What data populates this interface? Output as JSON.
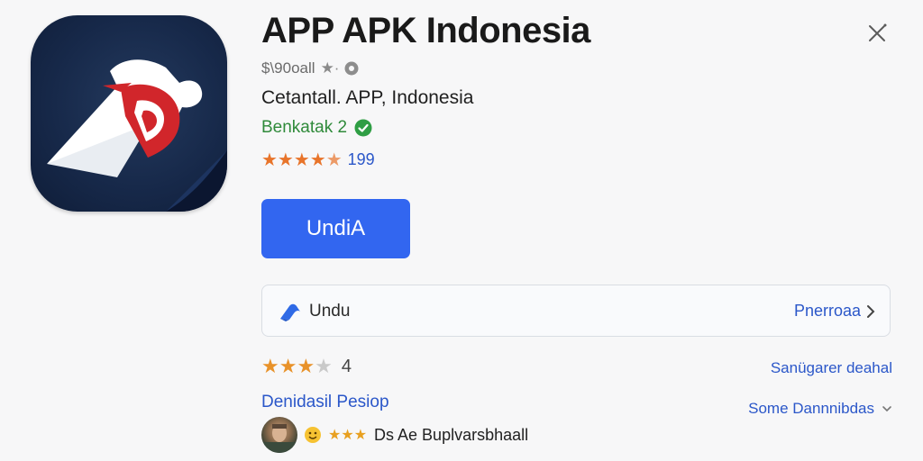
{
  "app": {
    "title": "APP APK  Indonesia",
    "developer": "$\\90oall",
    "subtitle": "Cetantall. APP, Indonesia",
    "verified_label": "Benkatak 2",
    "rating_stars": 4.5,
    "rating_count": "199"
  },
  "actions": {
    "install_label": "UndiA"
  },
  "download_bar": {
    "label": "Undu",
    "link_label": "Pnerroaa"
  },
  "reviews": {
    "stars": 3.5,
    "value": "4",
    "right_link": "Sanügarer deahal",
    "details_link": "Denidasil Pesiop",
    "more_link": "Some Dannnibdas",
    "reviewer_stars": 3,
    "reviewer_name": "Ds Ae Buplvarsbhaall"
  },
  "colors": {
    "accent": "#3266f0",
    "link": "#2b57c9",
    "verified": "#2f8a3a",
    "star": "#e8742a",
    "icon_bg": "#17294a",
    "icon_red": "#d1262b"
  },
  "icons": [
    "close-icon",
    "star-icon",
    "info-icon",
    "check-icon",
    "download-icon",
    "chevron-right-icon",
    "chevron-down-icon"
  ]
}
